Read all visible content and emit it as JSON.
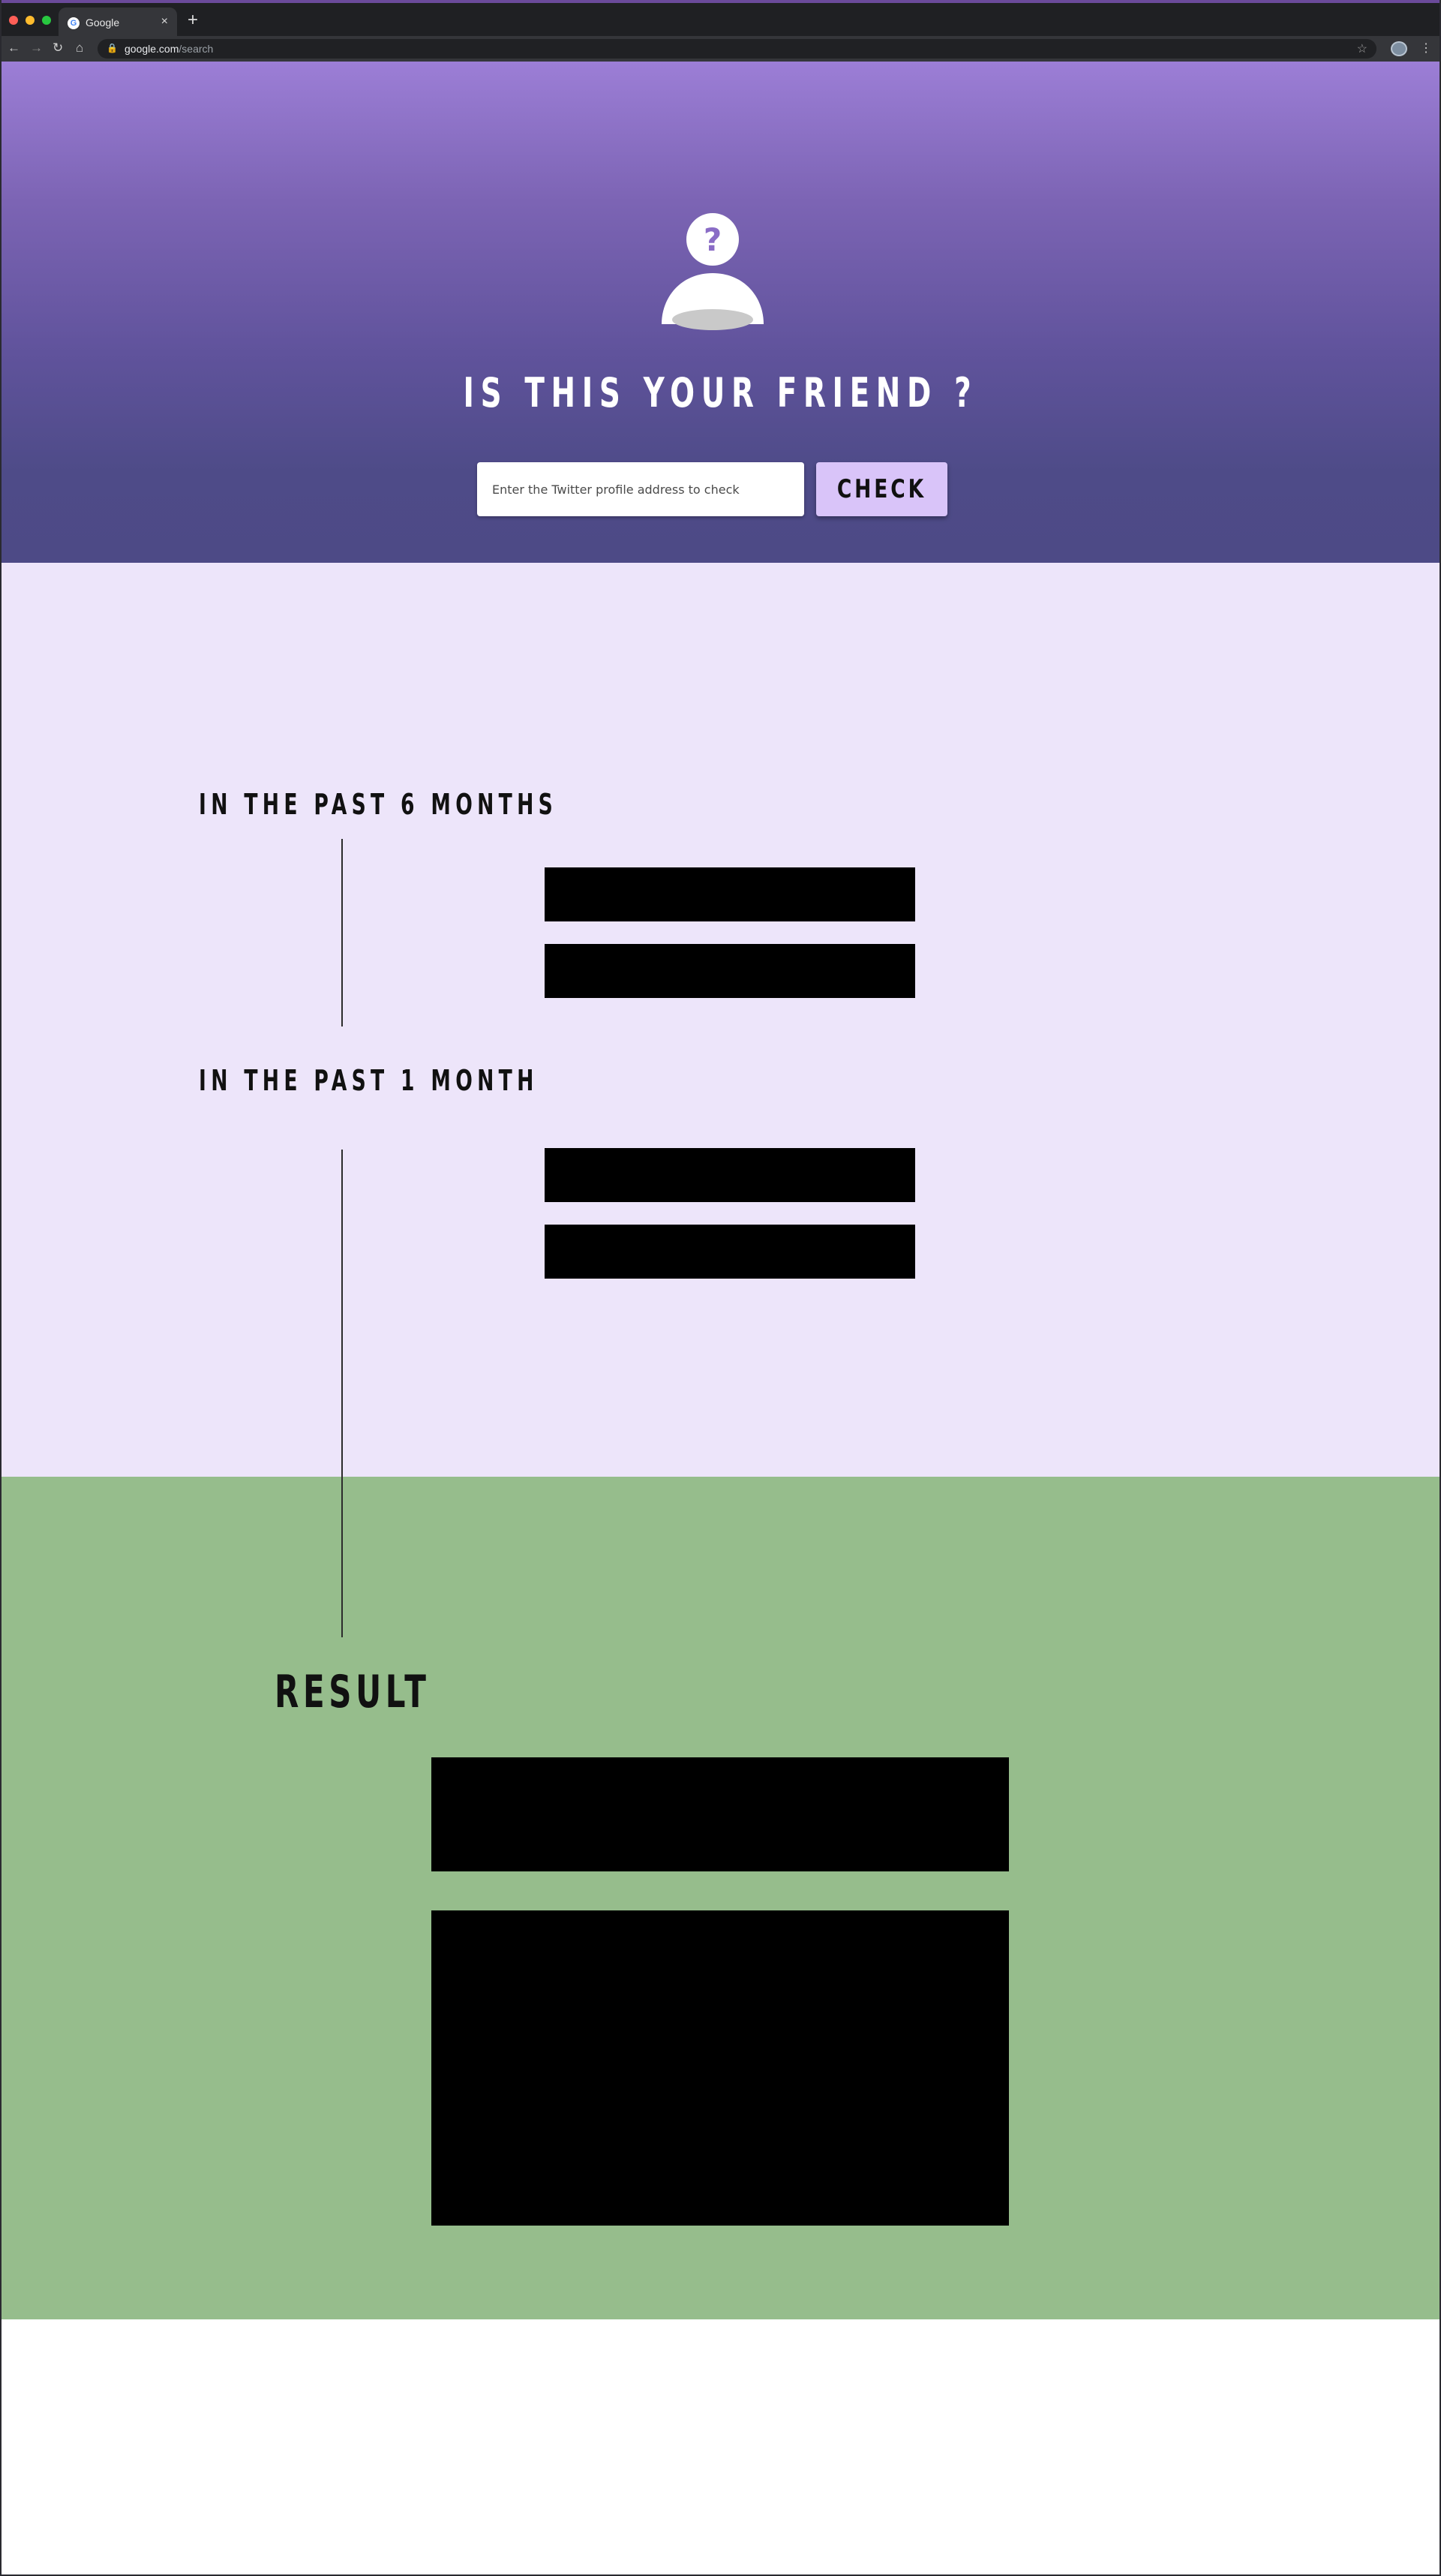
{
  "browser": {
    "tab_title": "Google",
    "tab_favicon": "G",
    "tab_close": "×",
    "new_tab": "+",
    "url_host": "google.com",
    "url_path": "/search",
    "icons": [
      "back-arrow-icon",
      "forward-arrow-icon",
      "reload-icon",
      "home-icon",
      "lock-icon",
      "star-icon",
      "profile-icon",
      "menu-icon"
    ]
  },
  "hero": {
    "title": "IS THIS YOUR FRIEND ?",
    "icon": "person-question-icon",
    "search_placeholder": "Enter the Twitter profile address to check",
    "check_label": "CHECK"
  },
  "timeline": {
    "heading_6_months": "IN THE PAST 6 MONTHS",
    "heading_1_month": "IN THE PAST 1 MONTH"
  },
  "result": {
    "heading": "RESULT"
  },
  "colors": {
    "hero_gradient_top": "#9c7ed6",
    "hero_gradient_bottom": "#4d4a86",
    "timeline_bg": "#ede5fa",
    "result_bg": "#96bd8c",
    "check_button_bg": "#d9c4f9",
    "redacted": "#000000"
  }
}
